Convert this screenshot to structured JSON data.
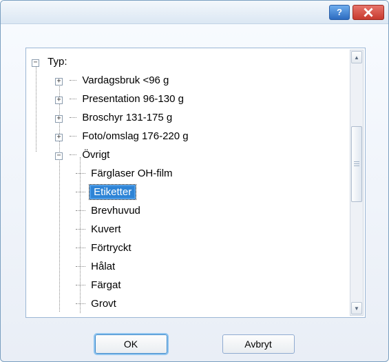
{
  "tree": {
    "root_label": "Typ:",
    "children": [
      {
        "label": "Vardagsbruk <96 g",
        "expanded": false
      },
      {
        "label": "Presentation 96-130 g",
        "expanded": false
      },
      {
        "label": "Broschyr 131-175 g",
        "expanded": false
      },
      {
        "label": "Foto/omslag 176-220 g",
        "expanded": false
      },
      {
        "label": "Övrigt",
        "expanded": true,
        "children": [
          {
            "label": "Färglaser OH-film",
            "selected": false
          },
          {
            "label": "Etiketter",
            "selected": true
          },
          {
            "label": "Brevhuvud",
            "selected": false
          },
          {
            "label": "Kuvert",
            "selected": false
          },
          {
            "label": "Förtryckt",
            "selected": false
          },
          {
            "label": "Hålat",
            "selected": false
          },
          {
            "label": "Färgat",
            "selected": false
          },
          {
            "label": "Grovt",
            "selected": false
          }
        ]
      }
    ]
  },
  "buttons": {
    "ok": "OK",
    "cancel": "Avbryt"
  },
  "glyphs": {
    "plus": "+",
    "minus": "−",
    "help": "?",
    "up": "▲",
    "down": "▼"
  }
}
